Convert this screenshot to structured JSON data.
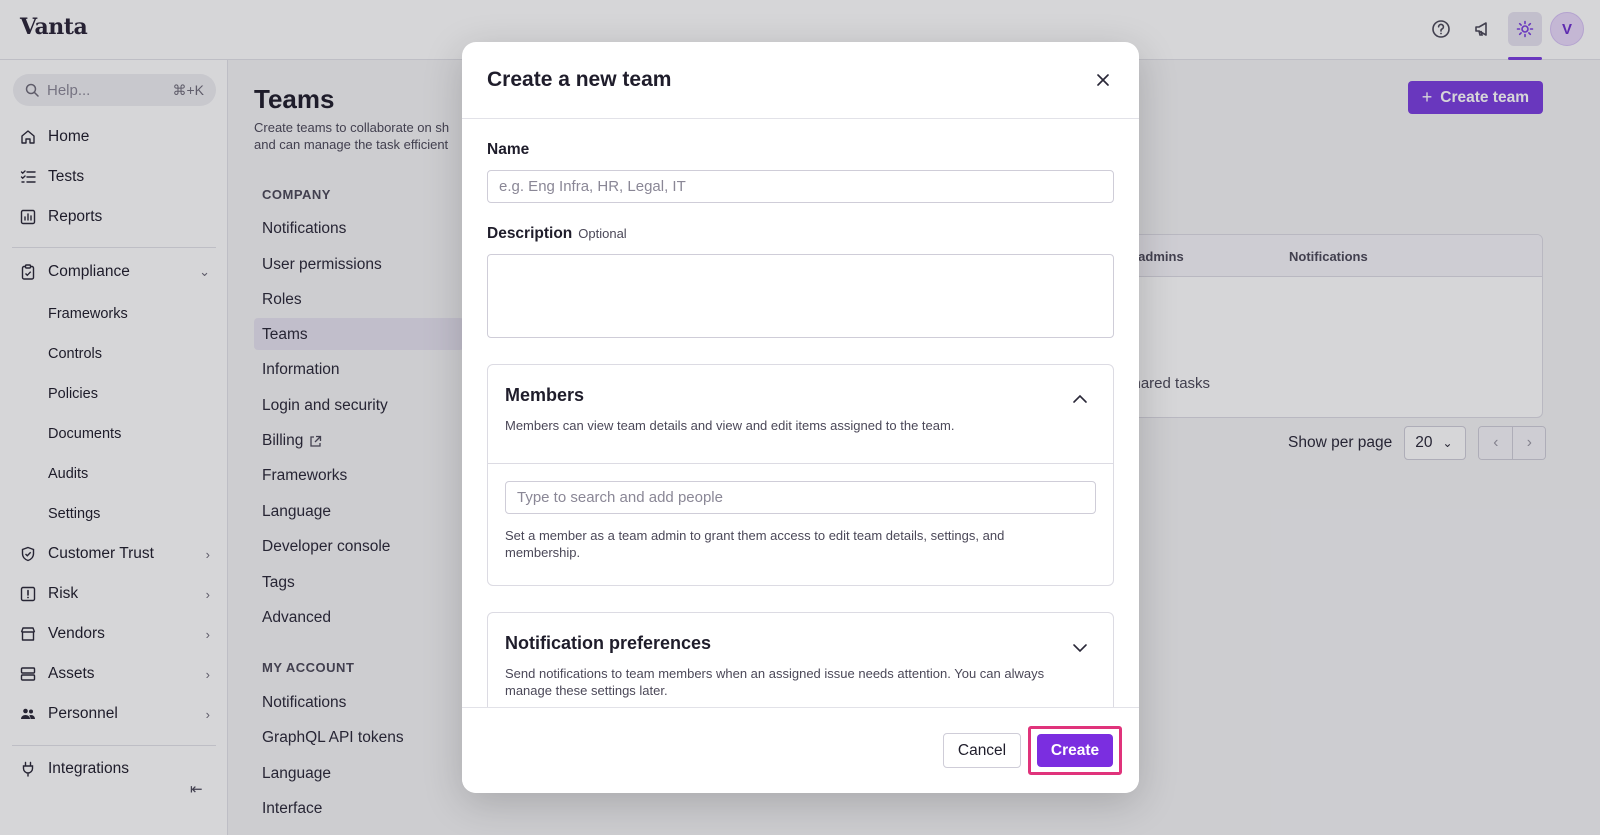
{
  "app": {
    "logo": "Vanta"
  },
  "topbar": {
    "help_icon": "help-circle-icon",
    "announcements_icon": "megaphone-icon",
    "settings_icon": "gear-icon",
    "avatar_letter": "V"
  },
  "sidebar": {
    "search_placeholder": "Help...",
    "search_shortcut": "⌘+K",
    "items": [
      {
        "label": "Home",
        "icon": "home-icon"
      },
      {
        "label": "Tests",
        "icon": "checklist-icon"
      },
      {
        "label": "Reports",
        "icon": "bar-chart-icon"
      },
      {
        "label": "Compliance",
        "icon": "clipboard-icon"
      },
      {
        "label": "Customer Trust",
        "icon": "shield-icon"
      },
      {
        "label": "Risk",
        "icon": "alert-square-icon"
      },
      {
        "label": "Vendors",
        "icon": "store-icon"
      },
      {
        "label": "Assets",
        "icon": "server-icon"
      },
      {
        "label": "Personnel",
        "icon": "people-icon"
      },
      {
        "label": "Integrations",
        "icon": "plug-icon"
      }
    ],
    "compliance_sub": [
      "Frameworks",
      "Controls",
      "Policies",
      "Documents",
      "Audits",
      "Settings"
    ]
  },
  "main": {
    "title": "Teams",
    "description_line1": "Create teams to collaborate on sh",
    "description_line2": "and can manage the task efficient",
    "company_label": "COMPANY",
    "company_items": [
      "Notifications",
      "User permissions",
      "Roles",
      "Teams",
      "Information",
      "Login and security",
      "Billing",
      "Frameworks",
      "Language",
      "Developer console",
      "Tags",
      "Advanced"
    ],
    "account_label": "MY ACCOUNT",
    "account_items": [
      "Notifications",
      "GraphQL API tokens",
      "Language",
      "Interface"
    ],
    "create_team_label": "Create team",
    "table": {
      "col_admins": "m admins",
      "col_notifications": "Notifications",
      "empty_text": "shared tasks"
    },
    "pager": {
      "label": "Show per page",
      "value": "20"
    }
  },
  "modal": {
    "title": "Create a new team",
    "name_label": "Name",
    "name_placeholder": "e.g. Eng Infra, HR, Legal, IT",
    "description_label": "Description",
    "description_optional": "Optional",
    "members": {
      "title": "Members",
      "desc": "Members can view team details and view and edit items assigned to the team.",
      "search_placeholder": "Type to search and add people",
      "help": "Set a member as a team admin to grant them access to edit team details, settings, and membership."
    },
    "notifications": {
      "title": "Notification preferences",
      "desc": "Send notifications to team members when an assigned issue needs attention. You can always manage these settings later."
    },
    "cancel_label": "Cancel",
    "create_label": "Create"
  },
  "colors": {
    "accent": "#7b3ee0",
    "highlight": "#e0337b"
  }
}
